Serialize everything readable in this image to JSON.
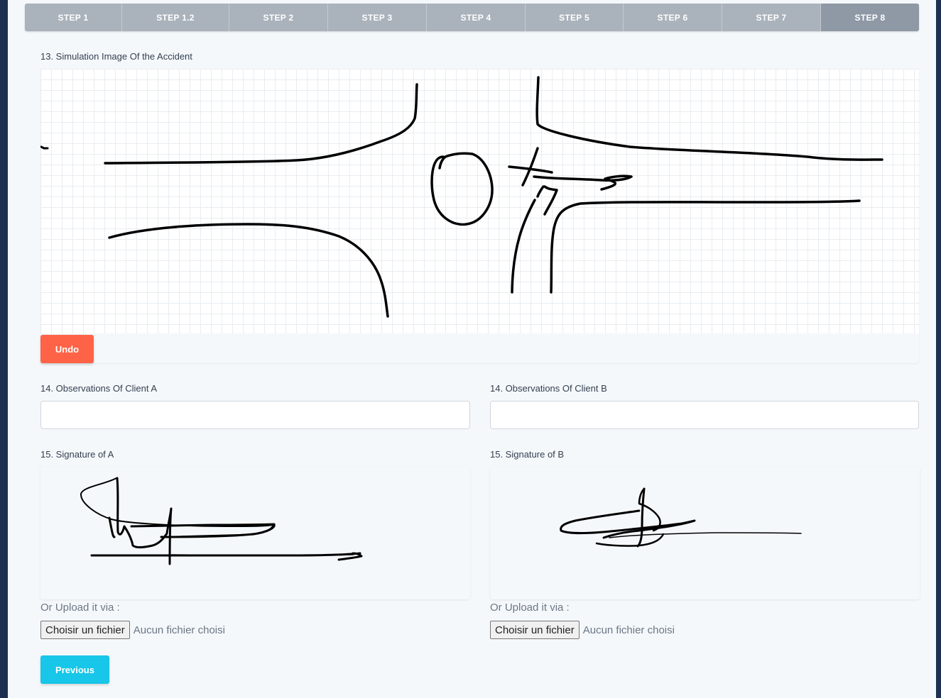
{
  "steps": [
    {
      "label": "STEP 1"
    },
    {
      "label": "STEP 1.2"
    },
    {
      "label": "STEP 2"
    },
    {
      "label": "STEP 3"
    },
    {
      "label": "STEP 4"
    },
    {
      "label": "STEP 5"
    },
    {
      "label": "STEP 6"
    },
    {
      "label": "STEP 7"
    },
    {
      "label": "STEP 8"
    }
  ],
  "active_step": "STEP 8",
  "simulation": {
    "label": "13. Simulation Image Of the Accident",
    "undo_label": "Undo"
  },
  "observations": {
    "a_label": "14. Observations Of Client A",
    "a_value": "",
    "b_label": "14. Observations Of Client B",
    "b_value": ""
  },
  "signatures": {
    "a_label": "15. Signature of A",
    "b_label": "15. Signature of B",
    "upload_label": "Or Upload it via :",
    "file_button": "Choisir un fichier",
    "file_status": "Aucun fichier choisi"
  },
  "nav": {
    "previous_label": "Previous"
  },
  "colors": {
    "undo": "#ff6347",
    "previous": "#17c6e8",
    "step_bar": "#aab2bb",
    "step_active": "#8e99a5"
  }
}
